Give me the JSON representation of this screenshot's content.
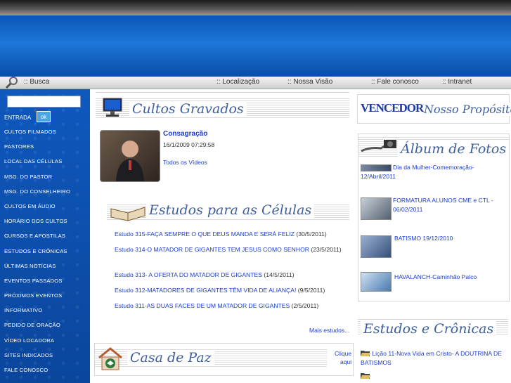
{
  "nav": {
    "busca": ":: Busca",
    "localizacao": ":: Localização",
    "nossa_visao": ":: Nossa Visão",
    "fale_conosco": ":: Fale conosco",
    "intranet": ":: Intranet"
  },
  "sidebar": {
    "search_value": "",
    "entrada_label": "ENTRADA",
    "ok_label": "ok",
    "items": [
      "CULTOS FILMADOS",
      "PASTORES",
      "LOCAL DAS CÉLULAS",
      "MSG. DO PASTOR",
      "MSG. DO CONSELHEIRO",
      "CULTOS EM ÁUDIO",
      "HORÁRIO DOS CULTOS",
      "CURSOS E APOSTILAS",
      "ESTUDOS E CRÔNICAS",
      "ÚLTIMAS NOTÍCIAS",
      "EVENTOS PASSADOS",
      "PRÓXIMOS EVENTOS",
      "INFORMATIVO",
      "PEDIDO DE ORAÇÃO",
      "VÍDEO LOCADORA",
      "SITES INDICADOS",
      "FALE CONOSCO"
    ]
  },
  "cultos": {
    "title": "Cultos Gravados",
    "video_title": "Consagração",
    "video_date": "16/1/2009 07:29:58",
    "all_videos": "Todos os Vídeos"
  },
  "estudos": {
    "title": "Estudos para as Células",
    "items": [
      {
        "link": "Estudo 315-FAÇA SEMPRE O QUE DEUS MANDA E SERÁ FELIZ",
        "date": " (30/5/2011)"
      },
      {
        "link": "Estudo 314-O MATADOR DE GIGANTES TEM JESUS COMO SENHOR",
        "date": " (23/5/2011)"
      },
      {
        "link": "Estudo 313- A OFERTA DO MATADOR DE GIGANTES",
        "date": " (14/5/2011)"
      },
      {
        "link": "Estudo 312-MATADORES DE GIGANTES TÊM VIDA DE ALIANÇA!",
        "date": " (9/5/2011)"
      },
      {
        "link": "Estudo 311-AS DUAS FACES DE UM MATADOR DE GIGANTES",
        "date": " (2/5/2011)"
      }
    ],
    "more": "Mais estudos..."
  },
  "casa": {
    "title": "Casa de Paz",
    "click_line1": "Clique",
    "click_line2": "aqui"
  },
  "proposito": {
    "logo": "VENCEDORES",
    "title": "Nosso Propósito"
  },
  "album": {
    "title": "Álbum de Fotos",
    "items": [
      "Dia da Mulher-Comemoração-12/Abril/2011",
      "FORMATURA ALUNOS CME e CTL - 06/02/2011",
      "BATISMO 19/12/2010",
      "HAVALANCH-Caminhão Palco"
    ]
  },
  "cronicas": {
    "title": "Estudos e Crônicas",
    "items": [
      "Lição 11-Nova Vida em Cristo- A DOUTRINA DE BATISMOS"
    ]
  },
  "colors": {
    "banner": "#1c77d9",
    "sidebar": "#0c4fae",
    "link": "#1a3ccc",
    "title": "#3f5f9a"
  }
}
